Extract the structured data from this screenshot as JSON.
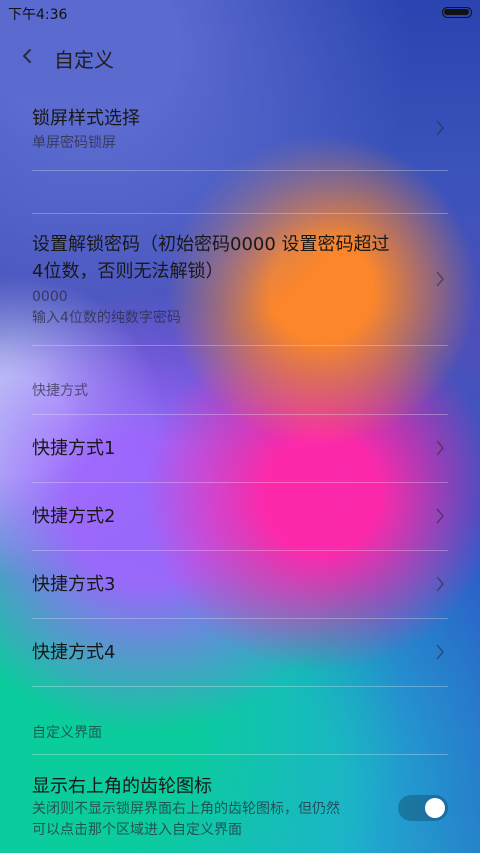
{
  "status_bar": {
    "time": "下午4:36",
    "battery_level": 1.0
  },
  "header": {
    "title": "自定义"
  },
  "items": [
    {
      "title": "锁屏样式选择",
      "subtitle": "单屏密码锁屏"
    },
    {
      "title_line1": "设置解锁密码（初始密码0000  设置密码超过",
      "title_line2": "4位数，否则无法解锁）",
      "value": "0000",
      "hint": "输入4位数的纯数字密码"
    }
  ],
  "sections": {
    "shortcuts": "快捷方式",
    "custom_ui": "自定义界面"
  },
  "shortcuts": [
    {
      "label": "快捷方式1"
    },
    {
      "label": "快捷方式2"
    },
    {
      "label": "快捷方式3"
    },
    {
      "label": "快捷方式4"
    }
  ],
  "gear_setting": {
    "title": "显示右上角的齿轮图标",
    "description_line1": "关闭则不显示锁屏界面右上角的齿轮图标，但仍然",
    "description_line2": "可以点击那个区域进入自定义界面",
    "enabled": true
  },
  "colors": {
    "accent": "#ffffff",
    "text": "#181818"
  }
}
